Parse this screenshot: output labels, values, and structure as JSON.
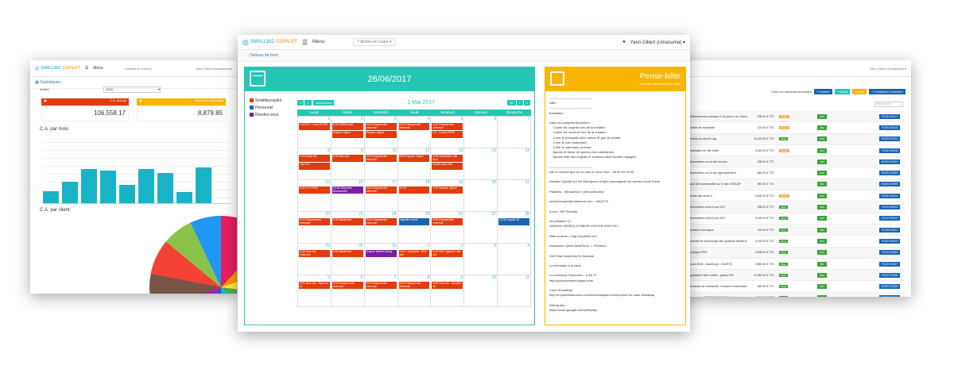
{
  "brand": {
    "part1": "SMALLBIZ",
    "part2": "COPILOT",
    "menu": "Menu"
  },
  "main": {
    "task_select": "7 tâches en cours ▾",
    "user": "Yann Gibert (Umasuma) ▾",
    "breadcrumb": "Tableau de bord",
    "agenda": {
      "date": "26/06/2017",
      "month": "1 Mai 2017",
      "today_btn": "Aujourd'hui",
      "prev_btn": "<",
      "next_btn": ">",
      "view_btns": [
        "30",
        "7",
        "1"
      ],
      "legend": [
        {
          "label": "Smallbizcopilot",
          "color": "#e13c0c"
        },
        {
          "label": "Personnel",
          "color": "#1a64b3"
        },
        {
          "label": "Rendez-vous",
          "color": "#7b1fa2"
        }
      ],
      "days": [
        "Lundi",
        "Mardi",
        "Mercredi",
        "Jeudi",
        "Vendredi",
        "Samedi",
        "Dimanche"
      ],
      "weeks": [
        [
          {
            "d": "1",
            "ev": [
              {
                "t": "9:00 LTI : Cours PHSE",
                "c": "red"
              }
            ]
          },
          {
            "d": "2",
            "ev": [
              {
                "t": "9:00 SMDDocks",
                "c": "red"
              },
              {
                "t": "Espace Japon",
                "c": "red"
              }
            ]
          },
          {
            "d": "3",
            "ev": [
              {
                "t": "9:00 Easyservice Informat",
                "c": "red"
              },
              {
                "t": "Espace Japon",
                "c": "red"
              }
            ]
          },
          {
            "d": "4",
            "ev": [
              {
                "t": "9:00 Easyservice Informat",
                "c": "red"
              }
            ]
          },
          {
            "d": "5",
            "ev": [
              {
                "t": "9:00 Easyservice Informat",
                "c": "red"
              },
              {
                "t": "LTI : Cours PHSE",
                "c": "red"
              }
            ]
          },
          {
            "d": "6",
            "ev": []
          },
          {
            "d": "7",
            "ev": []
          }
        ],
        [
          {
            "d": "8",
            "ev": [
              {
                "t": "9:00 Dose etc",
                "c": "red"
              },
              {
                "t": "Yael LTI",
                "c": "red"
              }
            ]
          },
          {
            "d": "9",
            "ev": [
              {
                "t": "9:00 New etc",
                "c": "red"
              }
            ]
          },
          {
            "d": "10",
            "ev": [
              {
                "t": "9:00 Easyservice Informat",
                "c": "red"
              }
            ]
          },
          {
            "d": "11",
            "ev": [
              {
                "t": "9:00 Espace Japon",
                "c": "red"
              }
            ]
          },
          {
            "d": "12",
            "ev": [
              {
                "t": "9:00 Newsletter Ote ahm",
                "c": "red"
              },
              {
                "t": "Modifs New Def",
                "c": "red"
              }
            ]
          },
          {
            "d": "13",
            "ev": []
          },
          {
            "d": "14",
            "ev": []
          }
        ],
        [
          {
            "d": "15",
            "ev": [
              {
                "t": "9:00 LTI PHSE",
                "c": "red"
              }
            ]
          },
          {
            "d": "16",
            "ev": [
              {
                "t": "13:00 Déjeuner Emmanuell",
                "c": "purple"
              }
            ]
          },
          {
            "d": "17",
            "ev": [
              {
                "t": "9:00 Easyservice Informat",
                "c": "red"
              }
            ]
          },
          {
            "d": "18",
            "ev": [
              {
                "t": "21:00",
                "c": "red"
              }
            ]
          },
          {
            "d": "19",
            "ev": [
              {
                "t": "9:00 Espace Japon",
                "c": "red"
              }
            ]
          },
          {
            "d": "20",
            "ev": []
          },
          {
            "d": "21",
            "ev": []
          }
        ],
        [
          {
            "d": "22",
            "ev": [
              {
                "t": "9:00 Easyservice Informat",
                "c": "red"
              }
            ]
          },
          {
            "d": "23",
            "ev": [
              {
                "t": "9:00 Madimadi",
                "c": "red"
              }
            ]
          },
          {
            "d": "24",
            "ev": [
              {
                "t": "9:00 Easyservice Informat",
                "c": "red"
              }
            ]
          },
          {
            "d": "25",
            "ev": [
              {
                "t": "Vignette crit'air",
                "c": "blue"
              }
            ]
          },
          {
            "d": "26",
            "ev": [
              {
                "t": "9:00 Easyservice Informat",
                "c": "red"
              }
            ]
          },
          {
            "d": "27",
            "ev": []
          },
          {
            "d": "28",
            "ev": [
              {
                "t": "13:00 Impôts 1€",
                "c": "blue"
              }
            ]
          }
        ],
        [
          {
            "d": "29",
            "ev": [
              {
                "t": "9:00 New etc : Potomac",
                "c": "red"
              }
            ]
          },
          {
            "d": "30",
            "ev": [
              {
                "t": "9:00 Madimadi",
                "c": "red"
              }
            ]
          },
          {
            "d": "31",
            "ev": [
              {
                "t": "Copine Michel Kouig",
                "c": "purple"
              }
            ]
          },
          {
            "d": "1",
            "ev": [
              {
                "t": "9:00 L'Elephant : ROV anc",
                "c": "red"
              }
            ]
          },
          {
            "d": "2",
            "ev": [
              {
                "t": "9:00 SOF Agence Lise Art",
                "c": "red"
              }
            ]
          },
          {
            "d": "3",
            "ev": []
          },
          {
            "d": "4",
            "ev": []
          }
        ],
        [
          {
            "d": "5",
            "ev": [
              {
                "t": "9:00 New etc : Synchro et",
                "c": "red"
              }
            ]
          },
          {
            "d": "6",
            "ev": [
              {
                "t": "9:00 Easyservice Informat",
                "c": "red"
              }
            ]
          },
          {
            "d": "7",
            "ev": [
              {
                "t": "9:00 Easyservice Informat",
                "c": "red"
              }
            ]
          },
          {
            "d": "8",
            "ev": [
              {
                "t": "9:00 Easyservice Informat",
                "c": "red"
              }
            ]
          },
          {
            "d": "9",
            "ev": [
              {
                "t": "9:00 New etc : Scopies de",
                "c": "red"
              }
            ]
          },
          {
            "d": "10",
            "ev": []
          },
          {
            "d": "11",
            "ev": []
          }
        ]
      ]
    },
    "notes": {
      "title": "Pense-bête",
      "subtitle": "Prendre des notes à la volée",
      "body": "----------------------------------------\nSBD :\n----------------------------------------\nA finaliser :\n\nDans les comptes Abonnées :\n  - Copier les origines lors de la création\n  - Copier les secteurs lors de la création\n  - Créer le principals avec même ID que la société\n  - Créer le user (calendar)\n  - Créer le calendars de base\n  - Ajouter le tâche de synchro des calendriers\n  - Ajouter liste des origines et secteurs dans l'admin réglages\n\n----------------------------------------\nvoir le contact que j'ai eu cas ou, Ann Chuc : 06 80 81 04 03\n\nInstaller Updraft sur les Wordpress et faire sauvegarde sur serveur local Home.\n\nParallels : Windows10 / pfenum8oxbox\n\ncontact-buyer@umasuma.com  / s!tc3779\n\nA voir : WP Security\n\ncle parallels 12 :\n4ANAZA-X8H9Q4-67WBGR-V87GPB-XMXYHH\n\nWeb sockets > http://socketio.me/\n\nInscription OpenClassRoom -> Premium\n\nVoir Khan Academy en français\n\nLa formation à la carte\n\nLa technique Pomodoro : a lire !!!\nhttp://pomodorotechnique.com/\n\nCours Bootstrap\nhttp://fr.openclassrooms.com/informatique/cours/prenez-en-main-bootstrap\n\nDebug php :\nhttps://code.google.com/p/firephp/"
    }
  },
  "left": {
    "breadcrumb": "Statistiques",
    "year_label": "Année",
    "year_value": "2016",
    "kpi1": {
      "label": "C.A. annuel",
      "value": "106,558.17",
      "color": "#e13c0c"
    },
    "kpi2": {
      "label": "Moyenne mensuelle",
      "value": "8,879.85",
      "color": "#f7b500"
    },
    "chart_title": "C.A. par mois",
    "pie_title": "C.A. par client"
  },
  "chart_data": {
    "type": "bar",
    "title": "C.A. par mois",
    "categories": [
      "",
      "",
      "",
      "",
      "",
      "",
      "",
      "",
      "",
      ""
    ],
    "values": [
      3.2,
      5.6,
      9.0,
      8.6,
      4.8,
      9.0,
      8.0,
      3.0,
      9.4,
      0
    ],
    "ylim": [
      0,
      18
    ]
  },
  "right": {
    "action_label": "Créer un nouveau document",
    "buttons": [
      {
        "label": "Facture",
        "color": "#1a64b3"
      },
      {
        "label": "Devis",
        "color": "#25c7b4"
      },
      {
        "label": "Avoir",
        "color": "#f7b500"
      },
      {
        "label": "Prestation à facturer",
        "color": "#1a64b3"
      }
    ],
    "search_placeholder": "Rechercher",
    "pdf_label": "PDF",
    "rows": [
      {
        "desc": "Référencement standard 1 Go pour 1 an / Renouvellement pour un an d'un nom de domaine",
        "amount": "308.40 € TTC",
        "status": "Ouvert",
        "status_color": "#f0ad4e",
        "ref": "FC20170517"
      },
      {
        "desc": "Modèle de newsletter",
        "amount": "720.00 € TTC",
        "status": "Ouvert",
        "status_color": "#f0ad4e",
        "ref": "FC20170516"
      },
      {
        "desc": "Refonte du site ffvi.org",
        "amount": "16,320.00 € TTC",
        "status": "Payé",
        "status_color": "#3aa43a",
        "ref": "DV20170101"
      },
      {
        "desc": "Réalisation du site Keller",
        "amount": "2,418.00 € TTC",
        "status": "Ouvert",
        "status_color": "#f0ad4e",
        "ref": "FC20170515"
      },
      {
        "desc": "Interventions sur le site furnues",
        "amount": "288.00 € TTC",
        "status": "",
        "status_color": "#3aa43a",
        "ref": "DV20170100"
      },
      {
        "desc": "Interventions sur le site agencelibrart.fr",
        "amount": "864.00 € TTC",
        "status": "",
        "status_color": "#3aa43a",
        "ref": "DV20170099"
      },
      {
        "desc": "Ajout de fonctionnalité sur le site LFMCAP",
        "amount": "960.00 € TTC",
        "status": "",
        "status_color": "#3aa43a",
        "ref": "DV20170098"
      },
      {
        "desc": "refonte site annie.fr",
        "amount": "4,635.20 € TTC",
        "status": "Ouvert",
        "status_color": "#f0ad4e",
        "ref": "FC20170514"
      },
      {
        "desc": "Interventions avril et mai 2017",
        "amount": "288.00 € TTC",
        "status": "Payé",
        "status_color": "#3aa43a",
        "ref": "FC20170513"
      },
      {
        "desc": "Interventions avril et mai 2017",
        "amount": "3,936.00 € TTC",
        "status": "Payé",
        "status_color": "#3aa43a",
        "ref": "FC20170512"
      },
      {
        "desc": "Domaine DomJapon",
        "amount": "180.00 € TTC",
        "status": "Payé",
        "status_color": "#3aa43a",
        "ref": "FC20170511"
      },
      {
        "desc": "Transfert de technologie site synthèse libraire.fr",
        "amount": "3,150.00 € TTC",
        "status": "Payé",
        "status_color": "#3aa43a",
        "ref": "FC20170510"
      },
      {
        "desc": "Armoquie PRO",
        "amount": "4,608.00 € TTC",
        "status": "Payé",
        "status_color": "#3aa43a",
        "ref": "FC20170509"
      },
      {
        "desc": "Cours 2016 - JavaScript - ITAVETH",
        "amount": "2,880.00 € TTC",
        "status": "Payé",
        "status_color": "#3aa43a",
        "ref": "FC20170507"
      },
      {
        "desc": "Application Web mobile - gestion RH",
        "amount": "10,080.00 € TTC",
        "status": "Payé",
        "status_color": "#3aa43a",
        "ref": "FC20170506"
      },
      {
        "desc": "Demande de commande, livraison et facturation Carillement.com",
        "amount": "360.40 € TTC",
        "status": "Payé",
        "status_color": "#3aa43a",
        "ref": "DV20170095"
      },
      {
        "desc": "Commande ENETS-0000000594 - Hébergement de votre antenne de la Victoire L'OPEX",
        "amount": "1,281.60 € TTC",
        "status": "Payé",
        "status_color": "#3aa43a",
        "ref": "FC20170508"
      }
    ]
  }
}
